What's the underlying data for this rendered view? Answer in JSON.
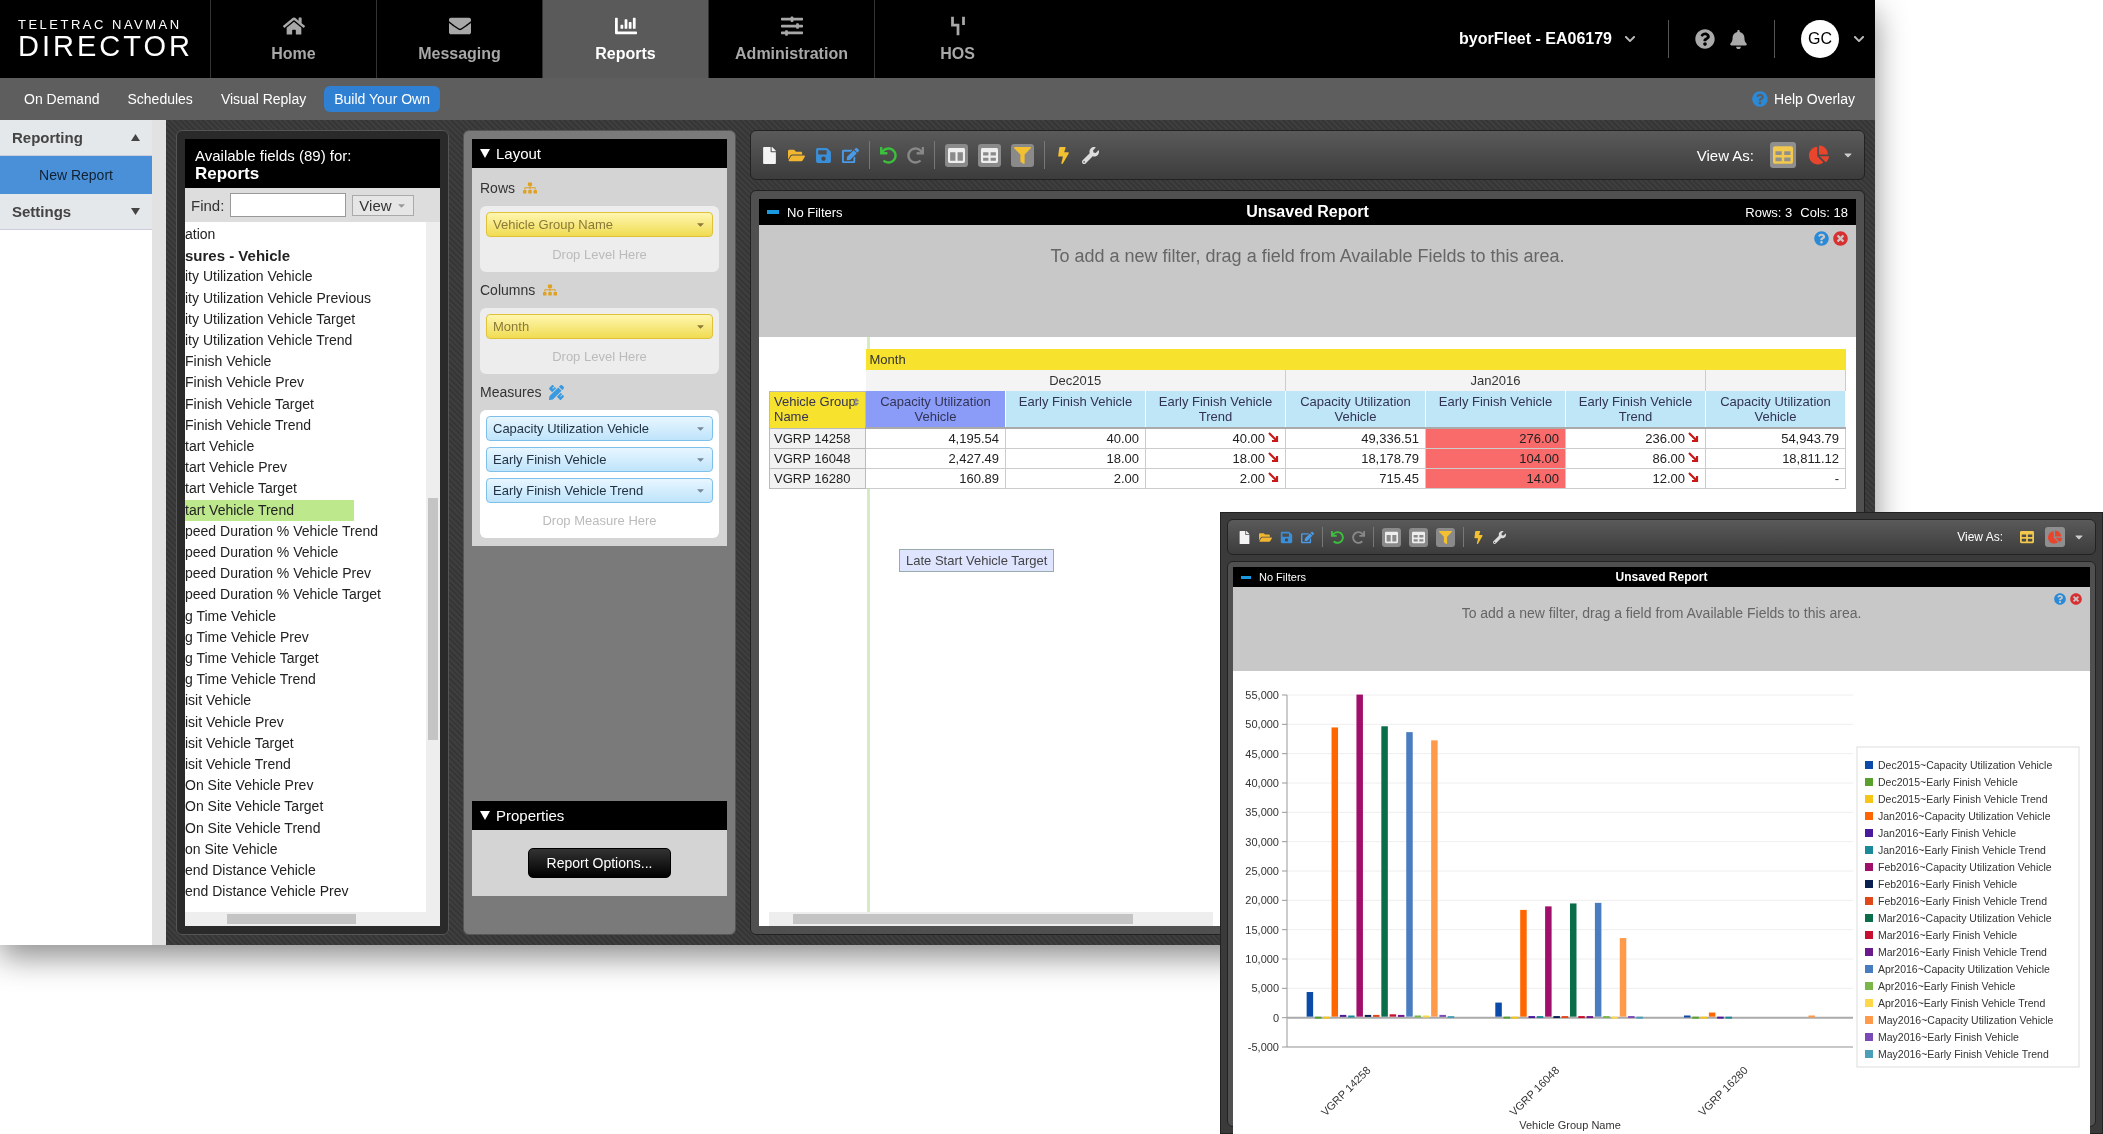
{
  "header": {
    "logo_top": "TELETRAC NAVMAN",
    "logo_bottom": "DIRECTOR",
    "nav": [
      {
        "label": "Home",
        "selected": false
      },
      {
        "label": "Messaging",
        "selected": false
      },
      {
        "label": "Reports",
        "selected": true
      },
      {
        "label": "Administration",
        "selected": false
      },
      {
        "label": "HOS",
        "selected": false
      }
    ],
    "account": "byorFleet - EA06179",
    "avatar": "GC"
  },
  "subnav": {
    "tabs": [
      {
        "label": "On Demand",
        "selected": false
      },
      {
        "label": "Schedules",
        "selected": false
      },
      {
        "label": "Visual Replay",
        "selected": false
      },
      {
        "label": "Build Your Own",
        "selected": true
      }
    ],
    "help": "Help Overlay"
  },
  "sidebar": {
    "sections": [
      {
        "label": "Reporting",
        "expanded": true,
        "items": [
          {
            "label": "New Report",
            "selected": true
          }
        ]
      },
      {
        "label": "Settings",
        "expanded": false
      }
    ]
  },
  "fields_panel": {
    "title": "Available fields (89) for:",
    "subtitle": "Reports",
    "find_label": "Find:",
    "view_button": "View",
    "items": [
      {
        "label": "ation",
        "kind": "item",
        "selected": false
      },
      {
        "label": "sures - Vehicle",
        "kind": "group",
        "selected": false
      },
      {
        "label": "ity Utilization Vehicle",
        "kind": "item",
        "selected": false
      },
      {
        "label": "ity Utilization Vehicle Previous",
        "kind": "item",
        "selected": false
      },
      {
        "label": "ity Utilization Vehicle Target",
        "kind": "item",
        "selected": false
      },
      {
        "label": "ity Utilization Vehicle Trend",
        "kind": "item",
        "selected": false
      },
      {
        "label": "Finish Vehicle",
        "kind": "item",
        "selected": false
      },
      {
        "label": "Finish Vehicle Prev",
        "kind": "item",
        "selected": false
      },
      {
        "label": "Finish Vehicle Target",
        "kind": "item",
        "selected": false
      },
      {
        "label": "Finish Vehicle Trend",
        "kind": "item",
        "selected": false
      },
      {
        "label": "tart Vehicle",
        "kind": "item",
        "selected": false
      },
      {
        "label": "tart Vehicle Prev",
        "kind": "item",
        "selected": false
      },
      {
        "label": "tart Vehicle Target",
        "kind": "item",
        "selected": false
      },
      {
        "label": "tart Vehicle Trend",
        "kind": "item",
        "selected": true
      },
      {
        "label": "peed Duration % Vehicle Trend",
        "kind": "item",
        "selected": false
      },
      {
        "label": "peed Duration % Vehicle",
        "kind": "item",
        "selected": false
      },
      {
        "label": "peed Duration % Vehicle Prev",
        "kind": "item",
        "selected": false
      },
      {
        "label": "peed Duration % Vehicle Target",
        "kind": "item",
        "selected": false
      },
      {
        "label": "g Time Vehicle",
        "kind": "item",
        "selected": false
      },
      {
        "label": "g Time Vehicle Prev",
        "kind": "item",
        "selected": false
      },
      {
        "label": "g Time Vehicle Target",
        "kind": "item",
        "selected": false
      },
      {
        "label": "g Time Vehicle Trend",
        "kind": "item",
        "selected": false
      },
      {
        "label": "isit Vehicle",
        "kind": "item",
        "selected": false
      },
      {
        "label": "isit Vehicle Prev",
        "kind": "item",
        "selected": false
      },
      {
        "label": "isit Vehicle Target",
        "kind": "item",
        "selected": false
      },
      {
        "label": "isit Vehicle Trend",
        "kind": "item",
        "selected": false
      },
      {
        "label": "On Site Vehicle Prev",
        "kind": "item",
        "selected": false
      },
      {
        "label": "On Site Vehicle Target",
        "kind": "item",
        "selected": false
      },
      {
        "label": "On Site Vehicle Trend",
        "kind": "item",
        "selected": false
      },
      {
        "label": "on Site Vehicle",
        "kind": "item",
        "selected": false
      },
      {
        "label": "end Distance Vehicle",
        "kind": "item",
        "selected": false
      },
      {
        "label": "end Distance Vehicle Prev",
        "kind": "item",
        "selected": false
      }
    ]
  },
  "layout_panel": {
    "title": "Layout",
    "rows_label": "Rows",
    "rows": [
      "Vehicle Group Name"
    ],
    "rows_drop": "Drop Level Here",
    "columns_label": "Columns",
    "columns": [
      "Month"
    ],
    "columns_drop": "Drop Level Here",
    "measures_label": "Measures",
    "measures": [
      "Capacity Utilization Vehicle",
      "Early Finish Vehicle",
      "Early Finish Vehicle Trend"
    ],
    "measures_drop": "Drop Measure Here",
    "properties_title": "Properties",
    "options_button": "Report Options..."
  },
  "report": {
    "view_as": "View As:",
    "view_modes": [
      {
        "kind": "grid",
        "selected": true
      },
      {
        "kind": "pie",
        "selected": false
      }
    ],
    "filters_label": "No Filters",
    "title": "Unsaved Report",
    "rows_count": "Rows: 3",
    "cols_count": "Cols: 18",
    "filter_hint": "To add a new filter, drag a field from Available Fields to this area.",
    "pivot": {
      "column_dimension": "Month",
      "months": [
        "Dec2015",
        "Jan2016"
      ],
      "row_header": "Vehicle Group Name",
      "columns": [
        {
          "label": "Capacity Utilization Vehicle",
          "kind": "value",
          "selected": true
        },
        {
          "label": "Early Finish Vehicle",
          "kind": "value",
          "selected": false
        },
        {
          "label": "Early Finish Vehicle Trend",
          "kind": "trend",
          "selected": false
        },
        {
          "label": "Capacity Utilization Vehicle",
          "kind": "value",
          "selected": false
        },
        {
          "label": "Early Finish Vehicle",
          "kind": "value",
          "selected": false
        },
        {
          "label": "Early Finish Vehicle Trend",
          "kind": "trend",
          "selected": false
        },
        {
          "label": "Capacity Utilization Vehicle",
          "kind": "value",
          "selected": false
        }
      ],
      "rows": [
        {
          "label": "VGRP 14258",
          "cells": [
            {
              "value": "4,195.54",
              "alert": false
            },
            {
              "value": "40.00",
              "alert": false
            },
            {
              "value": "40.00",
              "alert": false
            },
            {
              "value": "49,336.51",
              "alert": false
            },
            {
              "value": "276.00",
              "alert": true
            },
            {
              "value": "236.00",
              "alert": false
            },
            {
              "value": "54,943.79",
              "alert": false
            }
          ]
        },
        {
          "label": "VGRP 16048",
          "cells": [
            {
              "value": "2,427.49",
              "alert": false
            },
            {
              "value": "18.00",
              "alert": false
            },
            {
              "value": "18.00",
              "alert": false
            },
            {
              "value": "18,178.79",
              "alert": false
            },
            {
              "value": "104.00",
              "alert": true
            },
            {
              "value": "86.00",
              "alert": false
            },
            {
              "value": "18,811.12",
              "alert": false
            }
          ]
        },
        {
          "label": "VGRP 16280",
          "cells": [
            {
              "value": "160.89",
              "alert": false
            },
            {
              "value": "2.00",
              "alert": false
            },
            {
              "value": "2.00",
              "alert": false
            },
            {
              "value": "715.45",
              "alert": false
            },
            {
              "value": "14.00",
              "alert": true
            },
            {
              "value": "12.00",
              "alert": false
            },
            {
              "value": "-",
              "alert": false
            }
          ]
        }
      ]
    },
    "drag_chip": "Late Start Vehicle Target"
  },
  "chart_window": {
    "view_as": "View As:",
    "view_modes": [
      {
        "kind": "grid",
        "selected": false
      },
      {
        "kind": "pie",
        "selected": true
      }
    ],
    "filters_label": "No Filters",
    "title": "Unsaved Report",
    "filter_hint": "To add a new filter, drag a field from Available Fields to this area.",
    "chart_data": {
      "type": "bar",
      "grid": true,
      "legend": "right",
      "xlabel": "Vehicle Group Name",
      "categories": [
        "VGRP 14258",
        "VGRP 16048",
        "VGRP 16280"
      ],
      "ylim": [
        -5000,
        55000
      ],
      "yticks": [
        {
          "value": -5000,
          "label": "-5,000"
        },
        {
          "value": 0,
          "label": "0"
        },
        {
          "value": 5000,
          "label": "5,000"
        },
        {
          "value": 10000,
          "label": "10,000"
        },
        {
          "value": 15000,
          "label": "15,000"
        },
        {
          "value": 20000,
          "label": "20,000"
        },
        {
          "value": 25000,
          "label": "25,000"
        },
        {
          "value": 30000,
          "label": "30,000"
        },
        {
          "value": 35000,
          "label": "35,000"
        },
        {
          "value": 40000,
          "label": "40,000"
        },
        {
          "value": 45000,
          "label": "45,000"
        },
        {
          "value": 50000,
          "label": "50,000"
        },
        {
          "value": 55000,
          "label": "55,000"
        }
      ],
      "series": [
        {
          "name": "Dec2015~Capacity Utilization Vehicle",
          "color": "#0b4aa8",
          "values": [
            4200,
            2400,
            200
          ]
        },
        {
          "name": "Dec2015~Early Finish Vehicle",
          "color": "#5aa02c",
          "values": [
            0,
            0,
            0
          ]
        },
        {
          "name": "Dec2015~Early Finish Vehicle Trend",
          "color": "#f5c518",
          "values": [
            0,
            0,
            0
          ]
        },
        {
          "name": "Jan2016~Capacity Utilization Vehicle",
          "color": "#ff6600",
          "values": [
            49300,
            18200,
            700
          ]
        },
        {
          "name": "Jan2016~Early Finish Vehicle",
          "color": "#4b1a9c",
          "values": [
            300,
            100,
            0
          ]
        },
        {
          "name": "Jan2016~Early Finish Vehicle Trend",
          "color": "#1a8a9a",
          "values": [
            200,
            100,
            0
          ]
        },
        {
          "name": "Feb2016~Capacity Utilization Vehicle",
          "color": "#a0106a",
          "values": [
            54900,
            18800,
            null
          ]
        },
        {
          "name": "Feb2016~Early Finish Vehicle",
          "color": "#0a2050",
          "values": [
            300,
            100,
            null
          ]
        },
        {
          "name": "Feb2016~Early Finish Vehicle Trend",
          "color": "#e0481a",
          "values": [
            300,
            100,
            null
          ]
        },
        {
          "name": "Mar2016~Capacity Utilization Vehicle",
          "color": "#0a6e4a",
          "values": [
            49500,
            19300,
            null
          ]
        },
        {
          "name": "Mar2016~Early Finish Vehicle",
          "color": "#c8102e",
          "values": [
            400,
            100,
            null
          ]
        },
        {
          "name": "Mar2016~Early Finish Vehicle Trend",
          "color": "#6a1a8a",
          "values": [
            300,
            100,
            null
          ]
        },
        {
          "name": "Apr2016~Capacity Utilization Vehicle",
          "color": "#4a7cc0",
          "values": [
            48500,
            19400,
            null
          ]
        },
        {
          "name": "Apr2016~Early Finish Vehicle",
          "color": "#7ab648",
          "values": [
            200,
            100,
            null
          ]
        },
        {
          "name": "Apr2016~Early Finish Vehicle Trend",
          "color": "#ffd84a",
          "values": [
            200,
            0,
            null
          ]
        },
        {
          "name": "May2016~Capacity Utilization Vehicle",
          "color": "#ff9a4a",
          "values": [
            47100,
            13400,
            200
          ]
        },
        {
          "name": "May2016~Early Finish Vehicle",
          "color": "#7a4ab8",
          "values": [
            300,
            100,
            null
          ]
        },
        {
          "name": "May2016~Early Finish Vehicle Trend",
          "color": "#4aa0b8",
          "values": [
            100,
            0,
            null
          ]
        }
      ]
    }
  }
}
